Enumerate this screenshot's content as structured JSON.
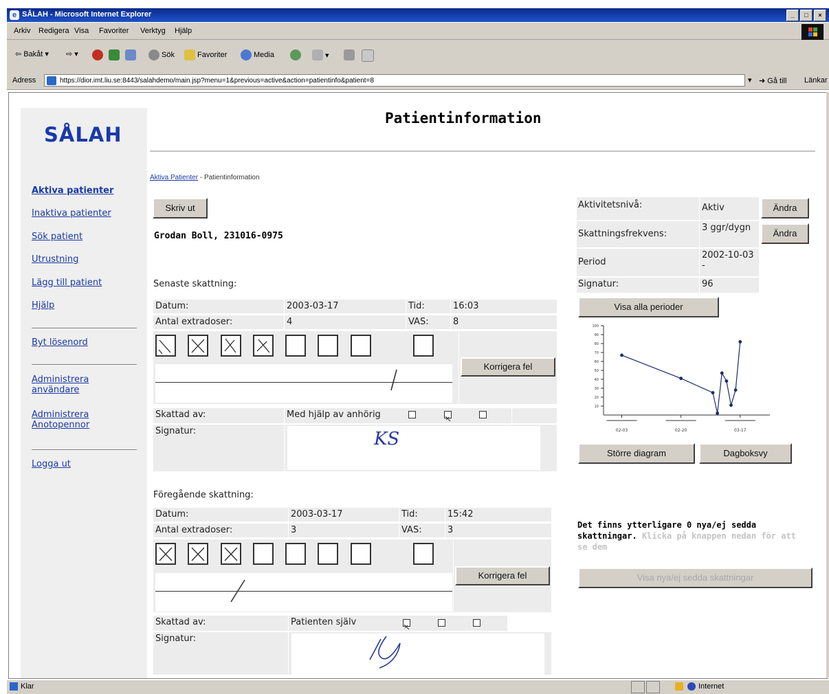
{
  "window": {
    "title": "SÅLAH - Microsoft Internet Explorer"
  },
  "menu": [
    "Arkiv",
    "Redigera",
    "Visa",
    "Favoriter",
    "Verktyg",
    "Hjälp"
  ],
  "toolbar": {
    "back": "Bakåt",
    "search": "Sök",
    "favorites": "Favoriter",
    "media": "Media"
  },
  "address": {
    "label": "Adress",
    "url": "https://dior.imt.liu.se:8443/salahdemo/main.jsp?menu=1&previous=active&action=patientinfo&patient=8",
    "go": "Gå till",
    "links": "Länkar"
  },
  "sidebar": {
    "brand": "SÅLAH",
    "items": [
      "Aktiva patienter",
      "Inaktiva patienter",
      "Sök patient",
      "Utrustning",
      "Lägg till patient",
      "Hjälp",
      "Byt lösenord",
      "Administrera användare",
      "Administrera Anotopennor",
      "Logga ut"
    ]
  },
  "page": {
    "title": "Patientinformation"
  },
  "breadcrumb": {
    "link": "Aktiva Patienter",
    "sep": " - ",
    "current": "Patientinformation"
  },
  "print_button": "Skriv ut",
  "patient": "Grodan Boll, 231016-0975",
  "latest": {
    "heading": "Senaste skattning:",
    "datum_label": "Datum:",
    "datum": "2003-03-17",
    "tid_label": "Tid:",
    "tid": "16:03",
    "extradoser_label": "Antal extradoser:",
    "extradoser": "4",
    "vas_label": "VAS:",
    "vas": "8",
    "correct_button": "Korrigera fel",
    "skattad_label": "Skattad av:",
    "skattad": "Med hjälp av anhörig",
    "signatur_label": "Signatur:",
    "signature": "KS"
  },
  "previous": {
    "heading": "Föregående skattning:",
    "datum_label": "Datum:",
    "datum": "2003-03-17",
    "tid_label": "Tid:",
    "tid": "15:42",
    "extradoser_label": "Antal extradoser:",
    "extradoser": "3",
    "vas_label": "VAS:",
    "vas": "3",
    "correct_button": "Korrigera fel",
    "skattad_label": "Skattad av:",
    "skattad": "Patienten själv",
    "signatur_label": "Signatur:"
  },
  "info": {
    "aktivitet_label": "Aktivitetsnivå:",
    "aktivitet": "Aktiv",
    "frekvens_label": "Skattningsfrekvens:",
    "frekvens": "3 ggr/dygn",
    "period_label": "Period",
    "period": "2002-10-03 -",
    "signatur_label": "Signatur:",
    "signatur": "96",
    "andra": "Ändra"
  },
  "show_periods_button": "Visa alla perioder",
  "larger_chart_button": "Större diagram",
  "diary_button": "Dagboksvy",
  "notice": {
    "bold": "Det finns ytterligare 0 nya/ej sedda skattningar.",
    "muted": "Klicka på knappen nedan för att se dem"
  },
  "show_new_button": "Visa nya/ej sedda skattningar",
  "statusbar": {
    "left": "Klar",
    "zone": "Internet"
  },
  "chart_data": {
    "type": "line",
    "x": [
      0,
      13,
      20,
      21,
      22,
      23,
      24,
      25,
      26
    ],
    "y": [
      67,
      41,
      25,
      2,
      47,
      38,
      11,
      28,
      82
    ],
    "ylim": [
      0,
      100
    ],
    "yticks": [
      10,
      20,
      30,
      40,
      50,
      60,
      70,
      80,
      90,
      100
    ],
    "xtick_labels": [
      "02-03",
      "02-20",
      "03-17"
    ]
  }
}
